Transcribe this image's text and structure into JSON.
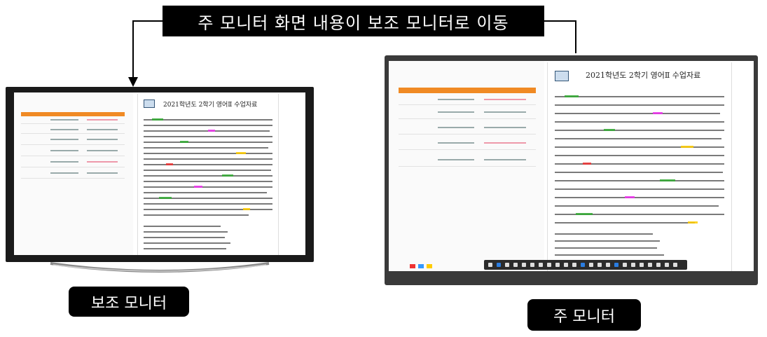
{
  "captions": {
    "top": "주 모니터 화면 내용이 보조 모니터로 이동",
    "secondary_label": "보조 모니터",
    "primary_label": "주 모니터"
  },
  "document": {
    "title": "2021학년도 2학기 영어Ⅱ 수업자료"
  }
}
